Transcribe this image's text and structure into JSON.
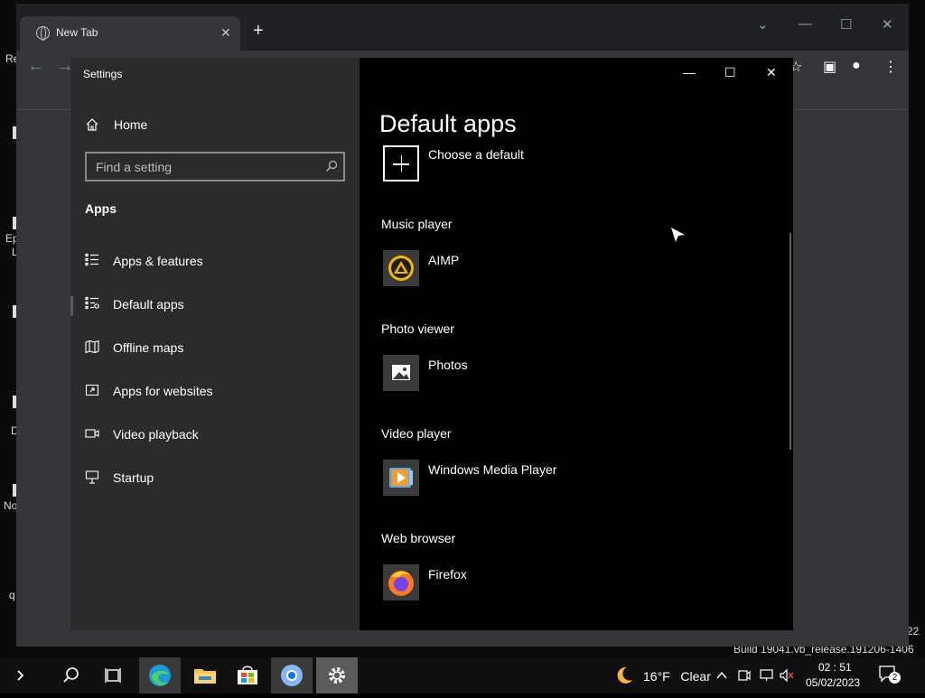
{
  "browser": {
    "tab_title": "New Tab",
    "tab_close": "✕",
    "new_tab": "+"
  },
  "settings": {
    "window_title": "Settings",
    "home_label": "Home",
    "search_placeholder": "Find a setting",
    "section_label": "Apps",
    "nav_items": [
      {
        "label": "Apps & features",
        "icon": "list-icon"
      },
      {
        "label": "Default apps",
        "icon": "default-apps-icon"
      },
      {
        "label": "Offline maps",
        "icon": "map-icon"
      },
      {
        "label": "Apps for websites",
        "icon": "open-external-icon"
      },
      {
        "label": "Video playback",
        "icon": "video-icon"
      },
      {
        "label": "Startup",
        "icon": "startup-icon"
      }
    ],
    "active_nav": "Default apps",
    "page_title": "Default apps",
    "choose_default": "Choose a default",
    "categories": [
      {
        "heading": "Music player",
        "app": "AIMP"
      },
      {
        "heading": "Photo viewer",
        "app": "Photos"
      },
      {
        "heading": "Video player",
        "app": "Windows Media Player"
      },
      {
        "heading": "Web browser",
        "app": "Firefox"
      }
    ]
  },
  "taskbar": {
    "weather_temp": "16°F",
    "weather_text": "Clear",
    "time": "02 : 51",
    "date": "05/02/2023",
    "notification_count": "2",
    "build_text": "Build 19041.vb_release.191206-1406",
    "build_edge_number": "22"
  },
  "desktop_fragments": [
    "Re",
    "Ep",
    "L",
    "D",
    "No",
    "q"
  ]
}
